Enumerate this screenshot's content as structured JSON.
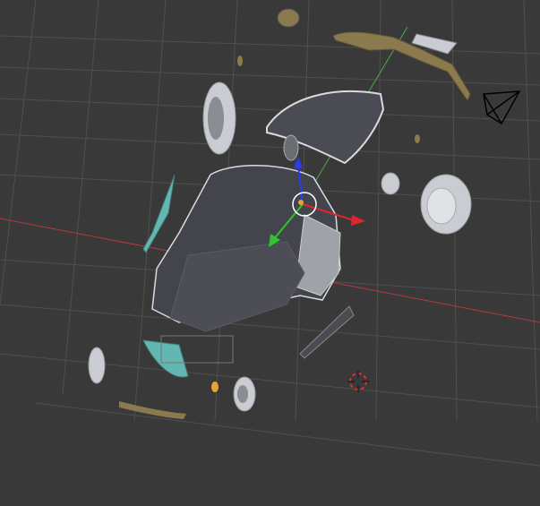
{
  "viewport": {
    "background": "#393939",
    "grid_color": "#4f4f4f",
    "x_axis_color": "#b5383f",
    "y_axis_color": "#4fa84b",
    "z_axis_color": "#3a46d8"
  },
  "scene": {
    "body_color": "#4d4e55",
    "glass_color": "#63b7b2",
    "chrome_color": "#c9ccd2",
    "trim_color": "#8a7a4e",
    "selection_outline": "#e8a433"
  },
  "gizmo": {
    "x_color": "#e0242d",
    "y_color": "#2fc52f",
    "z_color": "#2a3cf0",
    "pivot_ring_color": "#ffffff"
  },
  "cursor_3d": {
    "ring_color": "#e03030",
    "crosshair_color": "#111111"
  },
  "camera": {
    "wire_color": "#000000"
  }
}
